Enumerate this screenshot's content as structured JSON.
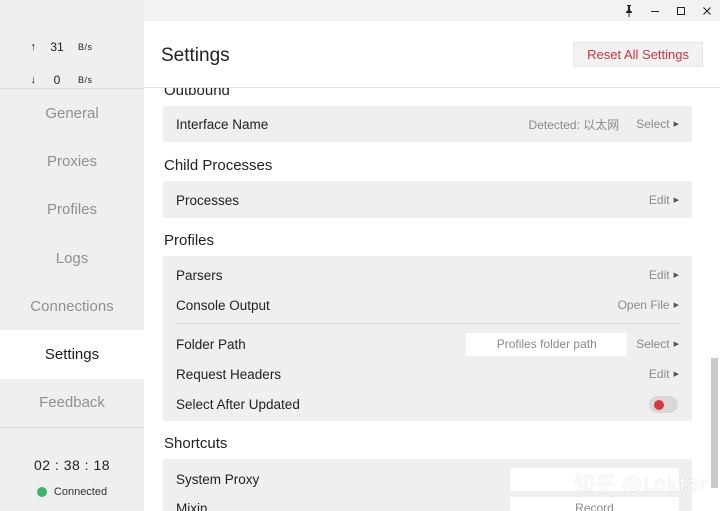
{
  "titlebar": {
    "pin_icon": "pin-icon",
    "minimize_icon": "minimize-icon",
    "maximize_icon": "maximize-icon",
    "close_icon": "close-icon"
  },
  "traffic": {
    "up_arrow": "↑",
    "up_value": "31",
    "up_unit": "B/s",
    "down_arrow": "↓",
    "down_value": "0",
    "down_unit": "B/s"
  },
  "nav": {
    "items": [
      {
        "label": "General"
      },
      {
        "label": "Proxies"
      },
      {
        "label": "Profiles"
      },
      {
        "label": "Logs"
      },
      {
        "label": "Connections"
      },
      {
        "label": "Settings"
      },
      {
        "label": "Feedback"
      }
    ],
    "active": "Settings"
  },
  "status": {
    "timer": "02 : 38 : 18",
    "connection": "Connected",
    "connection_color": "#3bb46e"
  },
  "header": {
    "title": "Settings",
    "reset_label": "Reset All Settings",
    "reset_color": "#d0343c"
  },
  "sections": {
    "outbound": {
      "title": "Outbound",
      "interface_name": {
        "label": "Interface Name",
        "detected": "Detected: 以太网",
        "action": "Select"
      }
    },
    "child_processes": {
      "title": "Child Processes",
      "processes": {
        "label": "Processes",
        "action": "Edit"
      }
    },
    "profiles": {
      "title": "Profiles",
      "parsers": {
        "label": "Parsers",
        "action": "Edit"
      },
      "console_output": {
        "label": "Console Output",
        "action": "Open File"
      },
      "folder_path": {
        "label": "Folder Path",
        "placeholder": "Profiles folder path",
        "action": "Select"
      },
      "request_headers": {
        "label": "Request Headers",
        "action": "Edit"
      },
      "select_after_updated": {
        "label": "Select After Updated",
        "enabled": false,
        "knob_color": "#d9363e"
      }
    },
    "shortcuts": {
      "title": "Shortcuts",
      "system_proxy": {
        "label": "System Proxy",
        "placeholder": ""
      },
      "mixin": {
        "label": "Mixin",
        "placeholder": "Record"
      }
    }
  },
  "watermark": "知乎 @Lokfar"
}
